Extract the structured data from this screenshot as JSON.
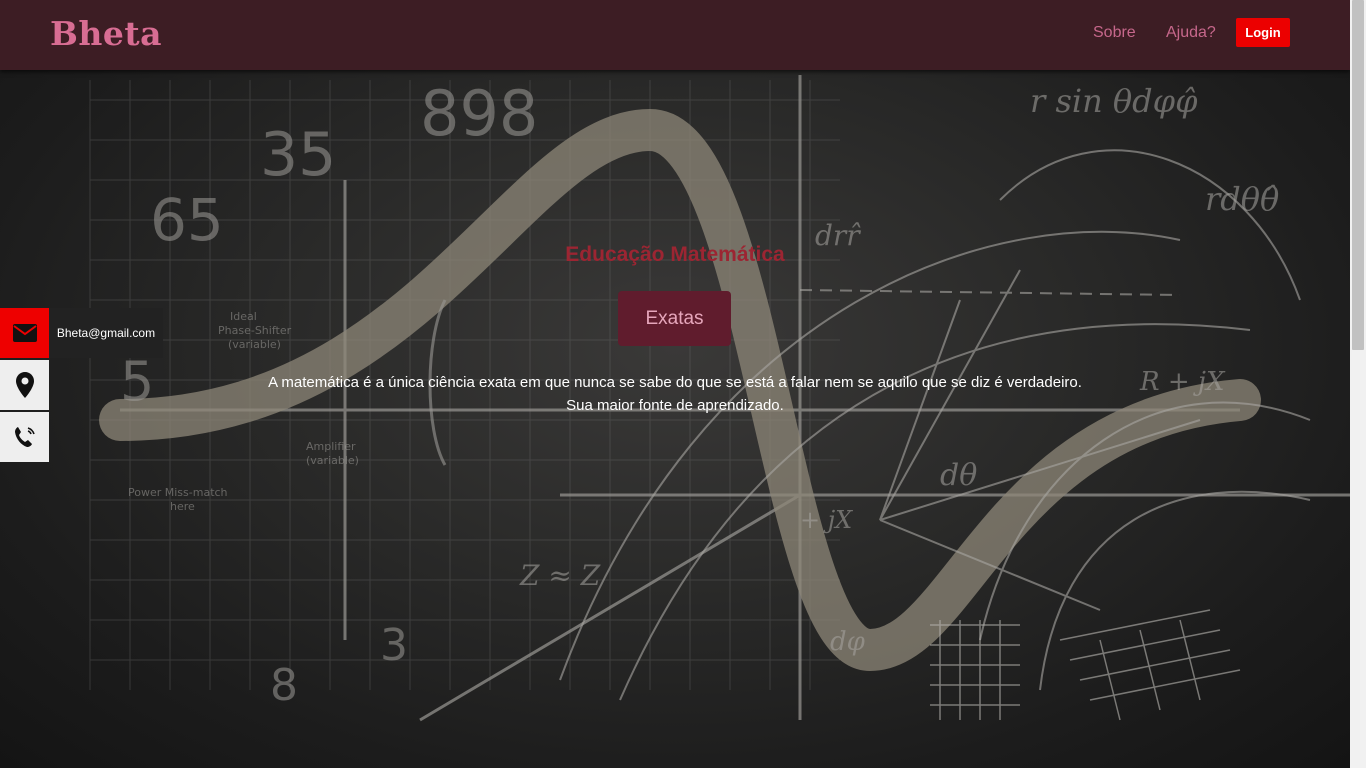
{
  "header": {
    "brand": "Bheta",
    "nav": [
      {
        "label": "Sobre"
      },
      {
        "label": "Ajuda?"
      }
    ],
    "login_label": "Login"
  },
  "hero": {
    "title": "Educação Matemática",
    "button_label": "Exatas",
    "text_line1": "A matemática é a única ciência exata em que nunca se sabe do que se está a falar nem se aquilo que se diz é verdadeiro.",
    "text_line2": "Sua maior fonte de aprendizado."
  },
  "contact": {
    "email": "Bheta@gmail.com",
    "icons": [
      "envelope-icon",
      "map-pin-icon",
      "phone-icon"
    ]
  },
  "colors": {
    "header_bg": "#3d1d24",
    "brand": "#d86d93",
    "nav_link": "#c6678b",
    "login_bg": "#ec0000",
    "hero_title": "#9c2532",
    "exatas_bg": "#601c2d",
    "mail_bg": "#ee0000"
  }
}
